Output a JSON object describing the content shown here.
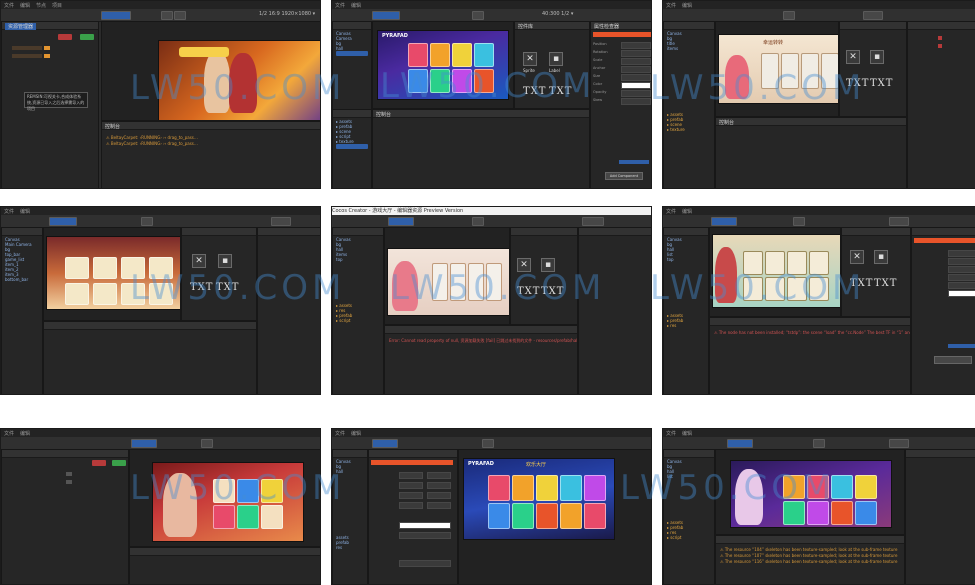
{
  "watermark": "LW50.COM",
  "tile1": {
    "tab_label": "资源管理器",
    "toolbar_res": "1/2 16:9 1920×1080 ▾",
    "tooltip": "REMSIN:可视关卡,合成体验系统,资源已导入之后选择需导入的项目",
    "buttons": {
      "red": "",
      "green": ""
    },
    "log": [
      "⚠ BeltayCarpet: ‹RUNNING› ›› drag_to_pass…",
      "⚠ BeltayCarpet: ‹RUNNING› ›› drag_to_pass…"
    ]
  },
  "tile2": {
    "title_label": "PYRAFAD",
    "toolbar_res": "40:300 1/2 ▾",
    "inspector_title": "属性检查器",
    "icon_labels": [
      "Sprite",
      "Label"
    ],
    "txt_icons": [
      "TXT",
      "TXT"
    ],
    "props": [
      "Position",
      "Rotation",
      "Scale",
      "Anchor",
      "Size",
      "Color",
      "Opacity",
      "Skew"
    ],
    "button": "Add Component"
  },
  "tile3": {
    "game_title": "幸运转转",
    "txt_icons": [
      "TXT",
      "TXT"
    ]
  },
  "tile4": {
    "txt_icons": [
      "TXT",
      "TXT"
    ],
    "tree": [
      "Canvas",
      "Main Camera",
      "bg",
      "top_bar",
      "game_list",
      "item_1",
      "item_2",
      "item_3",
      "bottom_bar"
    ]
  },
  "tile5": {
    "window_title": "Cocos Creator - 游戏大厅 - 编辑器资源 Preview Version",
    "error_line": "Error: Cannot read property of null, 资源加载失败 [fail] 已跳过未找到的文件 - resources/prefab/hall",
    "txt_icons": [
      "TXT",
      "TXT"
    ]
  },
  "tile6": {
    "txt_icons": [
      "TXT",
      "TXT"
    ],
    "error_line": "⚠ The node has not been installed; “tstdp”: the scene “load” the “cc.Node” The best TF in “1” and other…"
  },
  "tile7": {},
  "tile8": {
    "title": "PYRAFAD",
    "game_title": "欢乐大厅"
  },
  "tile9": {
    "log": [
      "⚠ The resource “104” skeleton has been texture-sampled; look at the sub-frame texture",
      "⚠ The resource “107” skeleton has been texture-sampled; look at the sub-frame texture",
      "⚠ The resource “116” skeleton has been texture-sampled; look at the sub-frame texture"
    ]
  },
  "colors": {
    "editor_bg": "#2b2b2b",
    "accent": "#2f5fa9",
    "warning": "#d89a3a",
    "error": "#d25353"
  }
}
